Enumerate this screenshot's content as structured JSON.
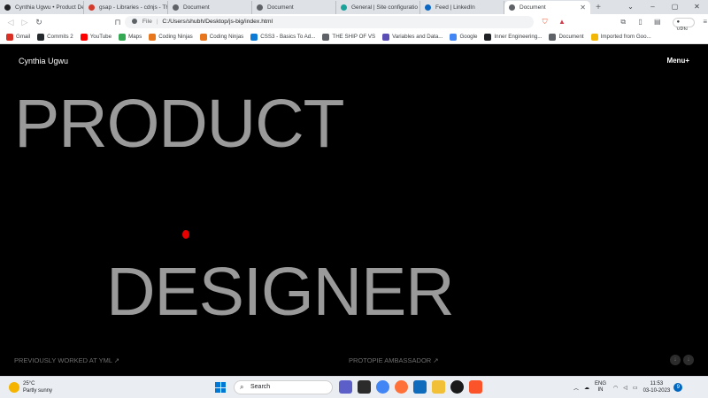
{
  "browser": {
    "tabs": [
      {
        "title": "Cynthia Ugwu • Product De",
        "color": "#202124"
      },
      {
        "title": "gsap - Libraries - cdnjs - Th",
        "color": "#d33b2c"
      },
      {
        "title": "Document",
        "color": "#5f6368"
      },
      {
        "title": "Document",
        "color": "#5f6368"
      },
      {
        "title": "General | Site configuratio",
        "color": "#1aa39b"
      },
      {
        "title": "Feed | LinkedIn",
        "color": "#0a66c2"
      },
      {
        "title": "Document",
        "color": "#5f6368",
        "active": true
      }
    ],
    "new_tab": "+",
    "address": {
      "file_label": "File",
      "separator": "|",
      "url": "C:/Users/shubh/Desktop/js-big/index.html"
    },
    "vpn_label": "VPN",
    "bookmarks": [
      {
        "label": "Gmail",
        "icon": "gmail-icon",
        "color": "#d93025"
      },
      {
        "label": "Commits 2",
        "icon": "github-icon",
        "color": "#24292e"
      },
      {
        "label": "YouTube",
        "icon": "youtube-icon",
        "color": "#ff0000"
      },
      {
        "label": "Maps",
        "icon": "maps-icon",
        "color": "#34a853"
      },
      {
        "label": "Coding Ninjas",
        "icon": "coding-ninjas-icon",
        "color": "#e8761c"
      },
      {
        "label": "Coding Ninjas",
        "icon": "coding-ninjas-icon",
        "color": "#e8761c"
      },
      {
        "label": "CSS3 - Basics To Ad...",
        "icon": "edge-icon",
        "color": "#0c7bd5"
      },
      {
        "label": "THE SHIP OF VS",
        "icon": "globe-icon",
        "color": "#5f6368"
      },
      {
        "label": "Variables and Data...",
        "icon": "book-icon",
        "color": "#5b4fb6"
      },
      {
        "label": "Google",
        "icon": "google-icon",
        "color": "#4285f4"
      },
      {
        "label": "Inner Engineering...",
        "icon": "video-icon",
        "color": "#202124"
      },
      {
        "label": "Document",
        "icon": "globe-icon",
        "color": "#5f6368"
      },
      {
        "label": "Imported from Goo...",
        "icon": "folder-icon",
        "color": "#f2b705"
      }
    ]
  },
  "site": {
    "brand": "Cynthia Ugwu",
    "menu": "Menu+",
    "hero_line1": "PRODUCT",
    "hero_line2": "DESIGNER",
    "footer_left": "PREVIOUSLY WORKED AT YML ↗",
    "footer_right": "PROTOPIE AMBASSADOR ↗",
    "arrow_down": "↓",
    "cursor_color": "#e60000"
  },
  "taskbar": {
    "temperature": "25°C",
    "weather": "Partly sunny",
    "search_placeholder": "Search",
    "lang_line1": "ENG",
    "lang_line2": "IN",
    "time": "11:53",
    "date": "03-10-2023",
    "notifications": "9"
  }
}
